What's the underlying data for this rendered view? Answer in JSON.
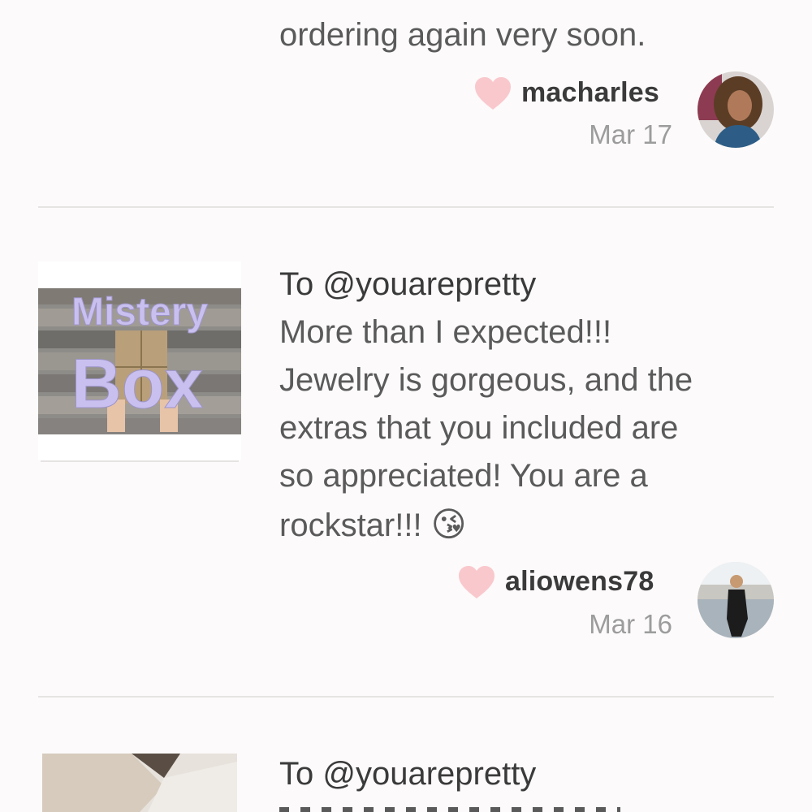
{
  "reviews": [
    {
      "body_tail": "ordering again very soon.",
      "username": "macharles",
      "date": "Mar 17",
      "heart_color": "#f9c8cd"
    },
    {
      "to": "To @youarepretty",
      "body_lines": [
        "More than I expected!!!",
        "Jewelry is gorgeous, and the",
        "extras that you included are",
        "so appreciated! You are a",
        "rockstar!!!"
      ],
      "emoji": "😘",
      "username": "aliowens78",
      "date": "Mar 16",
      "thumb_text_line1": "Mistery",
      "thumb_text_line2": "Box",
      "heart_color": "#f9c8cd"
    },
    {
      "to": "To @youarepretty"
    }
  ],
  "colors": {
    "background": "#fcfafa",
    "divider": "#e6e3e3",
    "heart": "#f9c8cd",
    "thumb_text": "#c9c0f0"
  },
  "icons": [
    "heart-icon",
    "avatar"
  ]
}
